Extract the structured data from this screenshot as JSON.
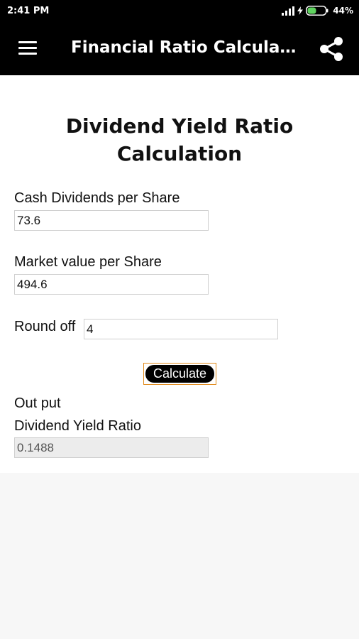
{
  "status_bar": {
    "time": "2:41 PM",
    "battery_percent": "44%",
    "icons": [
      "signal-icon",
      "charging-bolt-icon",
      "battery-icon"
    ]
  },
  "app_bar": {
    "title": "Financial Ratio Calculat…",
    "icons": [
      "menu-icon",
      "share-icon"
    ]
  },
  "form": {
    "heading": "Dividend Yield Ratio Calculation",
    "cash_dividends_label": "Cash Dividends per Share",
    "cash_dividends_value": "73.6",
    "market_value_label": "Market value per Share",
    "market_value_value": "494.6",
    "round_off_label": "Round off",
    "round_off_value": "4",
    "calculate_label": "Calculate"
  },
  "output": {
    "section_label": "Out put",
    "result_label": "Dividend Yield Ratio",
    "result_value": "0.1488"
  },
  "colors": {
    "bar_background": "#000000",
    "button_border": "#e08a1b",
    "battery_fill": "#5fd35f"
  }
}
